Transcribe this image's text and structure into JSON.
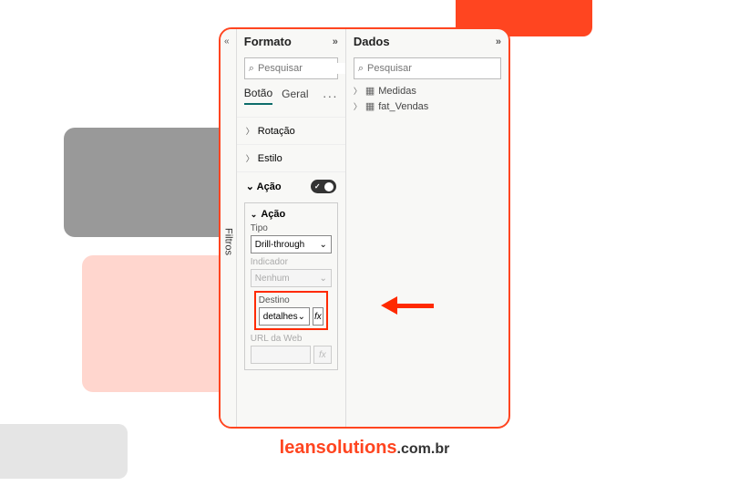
{
  "filtros_label": "Filtros",
  "format": {
    "title": "Formato",
    "search_placeholder": "Pesquisar",
    "tabs": {
      "botao": "Botão",
      "geral": "Geral"
    },
    "sections": {
      "rotacao": "Rotação",
      "estilo": "Estilo",
      "acao": "Ação"
    },
    "acao_sub": {
      "header": "Ação",
      "tipo_label": "Tipo",
      "tipo_value": "Drill-through",
      "indicador_label": "Indicador",
      "indicador_value": "Nenhum",
      "destino_label": "Destino",
      "destino_value": "detalhes",
      "url_label": "URL da Web"
    }
  },
  "dados": {
    "title": "Dados",
    "search_placeholder": "Pesquisar",
    "items": [
      {
        "name": "Medidas"
      },
      {
        "name": "fat_Vendas"
      }
    ]
  },
  "fx_label": "fx",
  "brand": {
    "main": "leansolutions",
    "suffix": ".com.br"
  }
}
